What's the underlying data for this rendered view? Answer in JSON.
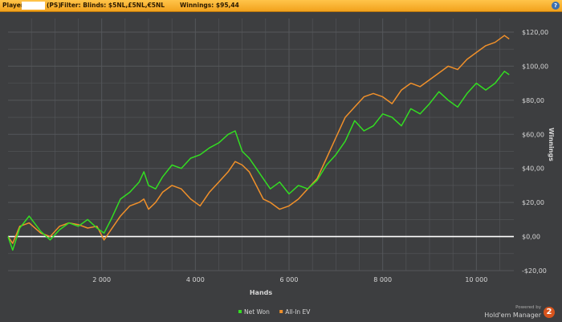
{
  "header": {
    "player_label": "Player:",
    "site_tag": "(PS)",
    "filter_text": "Filter: Blinds: $5NL,£5NL,€5NL",
    "winnings_text": "Winnings: $95,44",
    "help_glyph": "?"
  },
  "footer": {
    "powered_by": "Powered by",
    "brand": "Hold'em Manager",
    "brand_badge": "2"
  },
  "colors": {
    "net_won": "#33dd22",
    "all_in_ev": "#f0902a",
    "zero_line": "#ffffff",
    "grid": "#55575a",
    "text": "#d6d6d6"
  },
  "chart_data": {
    "type": "line",
    "xlabel": "Hands",
    "ylabel": "Winnings",
    "xlim": [
      0,
      10800
    ],
    "ylim": [
      -20,
      128
    ],
    "x_ticks": [
      2000,
      4000,
      6000,
      8000,
      10000
    ],
    "x_tick_labels": [
      "2 000",
      "4 000",
      "6 000",
      "8 000",
      "10 000"
    ],
    "y_ticks": [
      -20,
      0,
      20,
      40,
      60,
      80,
      100,
      120
    ],
    "y_tick_labels": [
      "-$20,00",
      "$0,00",
      "$20,00",
      "$40,00",
      "$60,00",
      "$80,00",
      "$100,00",
      "$120,00"
    ],
    "grid": true,
    "legend_position": "bottom-center",
    "series": [
      {
        "name": "Net Won",
        "color": "#33dd22",
        "x": [
          0,
          100,
          250,
          450,
          700,
          900,
          1100,
          1300,
          1500,
          1700,
          1900,
          2050,
          2200,
          2400,
          2600,
          2800,
          2900,
          3000,
          3150,
          3300,
          3500,
          3700,
          3900,
          4100,
          4300,
          4500,
          4700,
          4850,
          5000,
          5150,
          5300,
          5450,
          5600,
          5800,
          6000,
          6200,
          6400,
          6600,
          6800,
          7000,
          7200,
          7400,
          7600,
          7800,
          8000,
          8200,
          8400,
          8600,
          8800,
          9000,
          9200,
          9400,
          9600,
          9800,
          10000,
          10200,
          10400,
          10600,
          10700
        ],
        "values": [
          0,
          -8,
          5,
          12,
          3,
          -2,
          4,
          8,
          6,
          10,
          5,
          2,
          10,
          22,
          26,
          32,
          38,
          30,
          28,
          35,
          42,
          40,
          46,
          48,
          52,
          55,
          60,
          62,
          50,
          46,
          40,
          34,
          28,
          32,
          25,
          30,
          28,
          33,
          42,
          48,
          56,
          68,
          62,
          65,
          72,
          70,
          65,
          75,
          72,
          78,
          85,
          80,
          76,
          84,
          90,
          86,
          90,
          97,
          95
        ]
      },
      {
        "name": "All-In EV",
        "color": "#f0902a",
        "x": [
          0,
          100,
          250,
          450,
          700,
          900,
          1100,
          1300,
          1500,
          1700,
          1900,
          2050,
          2200,
          2400,
          2600,
          2800,
          2900,
          3000,
          3150,
          3300,
          3500,
          3700,
          3900,
          4100,
          4300,
          4500,
          4700,
          4850,
          5000,
          5150,
          5300,
          5450,
          5600,
          5800,
          6000,
          6200,
          6400,
          6600,
          6800,
          7000,
          7200,
          7400,
          7600,
          7800,
          8000,
          8200,
          8400,
          8600,
          8800,
          9000,
          9200,
          9400,
          9600,
          9800,
          10000,
          10200,
          10400,
          10600,
          10700
        ],
        "values": [
          0,
          -4,
          6,
          8,
          2,
          0,
          6,
          8,
          7,
          5,
          6,
          -2,
          4,
          12,
          18,
          20,
          22,
          16,
          20,
          26,
          30,
          28,
          22,
          18,
          26,
          32,
          38,
          44,
          42,
          38,
          30,
          22,
          20,
          16,
          18,
          22,
          28,
          34,
          46,
          58,
          70,
          76,
          82,
          84,
          82,
          78,
          86,
          90,
          88,
          92,
          96,
          100,
          98,
          104,
          108,
          112,
          114,
          118,
          116
        ]
      }
    ]
  }
}
